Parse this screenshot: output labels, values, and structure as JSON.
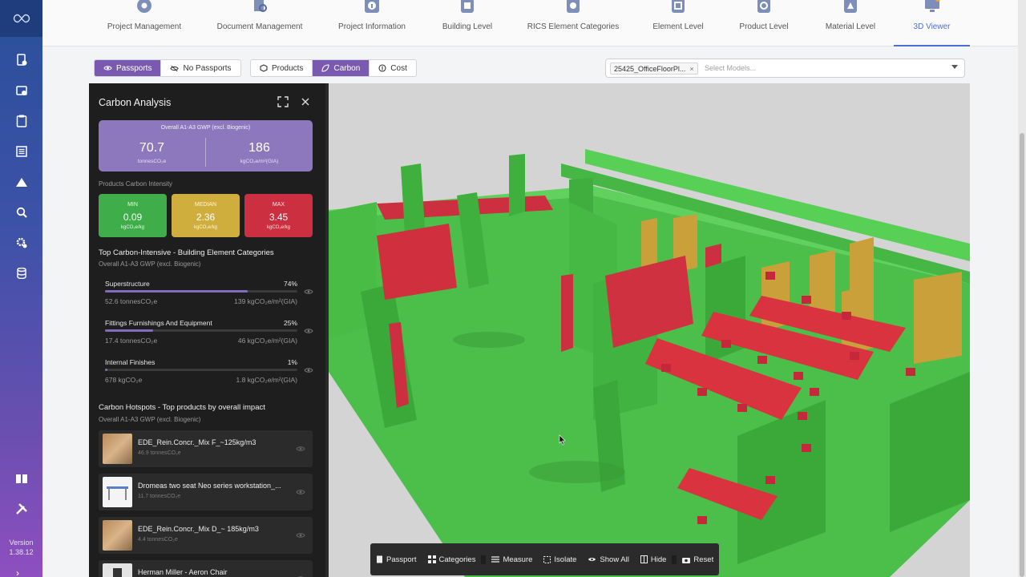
{
  "app": {
    "version_label": "Version",
    "version_number": "1.38.12",
    "accent": "#4a6fd6",
    "panel_accent": "#7a5ab0"
  },
  "top_tabs": [
    {
      "label": "Project Management",
      "icon": "gear-badge-icon"
    },
    {
      "label": "Document Management",
      "icon": "document-search-icon"
    },
    {
      "label": "Project Information",
      "icon": "info-icon"
    },
    {
      "label": "Building Level",
      "icon": "building-icon"
    },
    {
      "label": "RICS Element Categories",
      "icon": "categories-icon"
    },
    {
      "label": "Element Level",
      "icon": "element-icon"
    },
    {
      "label": "Product Level",
      "icon": "product-icon"
    },
    {
      "label": "Material Level",
      "icon": "material-icon"
    },
    {
      "label": "3D Viewer",
      "icon": "monitor-icon",
      "active": true
    }
  ],
  "toolbar": {
    "passports": "Passports",
    "no_passports": "No Passports",
    "products": "Products",
    "carbon": "Carbon",
    "cost": "Cost",
    "model_chip": "25425_OfficeFloorPl...",
    "model_placeholder": "Select Models..."
  },
  "panel": {
    "title": "Carbon Analysis",
    "overall": {
      "header": "Overall A1-A3 GWP (excl. Biogenic)",
      "total_value": "70.7",
      "total_unit": "tonnesCO₂e",
      "intensity_value": "186",
      "intensity_unit": "kgCO₂e/m²(GIA)"
    },
    "intensity_heading": "Products Carbon Intensity",
    "min": {
      "label": "MIN",
      "value": "0.09",
      "unit": "kgCO₂e/kg",
      "color": "#3fae4a"
    },
    "median": {
      "label": "MEDIAN",
      "value": "2.36",
      "unit": "kgCO₂e/kg",
      "color": "#cfae3e"
    },
    "max": {
      "label": "MAX",
      "value": "3.45",
      "unit": "kgCO₂e/kg",
      "color": "#cc2f3f"
    },
    "categories_heading": "Top Carbon-Intensive - Building Element Categories",
    "categories_sub": "Overall A1-A3 GWP (excl. Biogenic)",
    "categories": [
      {
        "name": "Superstructure",
        "percent": "74%",
        "fraction": 0.74,
        "tonnes": "52.6 tonnesCO₂e",
        "intensity": "139 kgCO₂e/m²(GIA)"
      },
      {
        "name": "Fittings Furnishings And Equipment",
        "percent": "25%",
        "fraction": 0.25,
        "tonnes": "17.4 tonnesCO₂e",
        "intensity": "46 kgCO₂e/m²(GIA)"
      },
      {
        "name": "Internal Finishes",
        "percent": "1%",
        "fraction": 0.01,
        "tonnes": "678 kgCO₂e",
        "intensity": "1.8 kgCO₂e/m²(GIA)"
      }
    ],
    "hotspots_heading": "Carbon Hotspots - Top products by overall impact",
    "hotspots_sub": "Overall A1-A3 GWP (excl. Biogenic)",
    "products": [
      {
        "name": "EDE_Rein.Concr._Mix F_~125kg/m3",
        "value": "46.9 tonnesCO₂e",
        "thumb": "concrete"
      },
      {
        "name": "Dromeas two seat Neo series workstation_...",
        "value": "11.7 tonnesCO₂e",
        "thumb": "desk"
      },
      {
        "name": "EDE_Rein.Concr._Mix D_~ 185kg/m3",
        "value": "4.4 tonnesCO₂e",
        "thumb": "concrete"
      },
      {
        "name": "Herman Miller - Aeron Chair",
        "value": "",
        "thumb": "chair"
      }
    ]
  },
  "viewer_tools": {
    "passport": "Passport",
    "categories": "Categories",
    "measure": "Measure",
    "isolate": "Isolate",
    "show_all": "Show All",
    "hide": "Hide",
    "reset": "Reset"
  }
}
